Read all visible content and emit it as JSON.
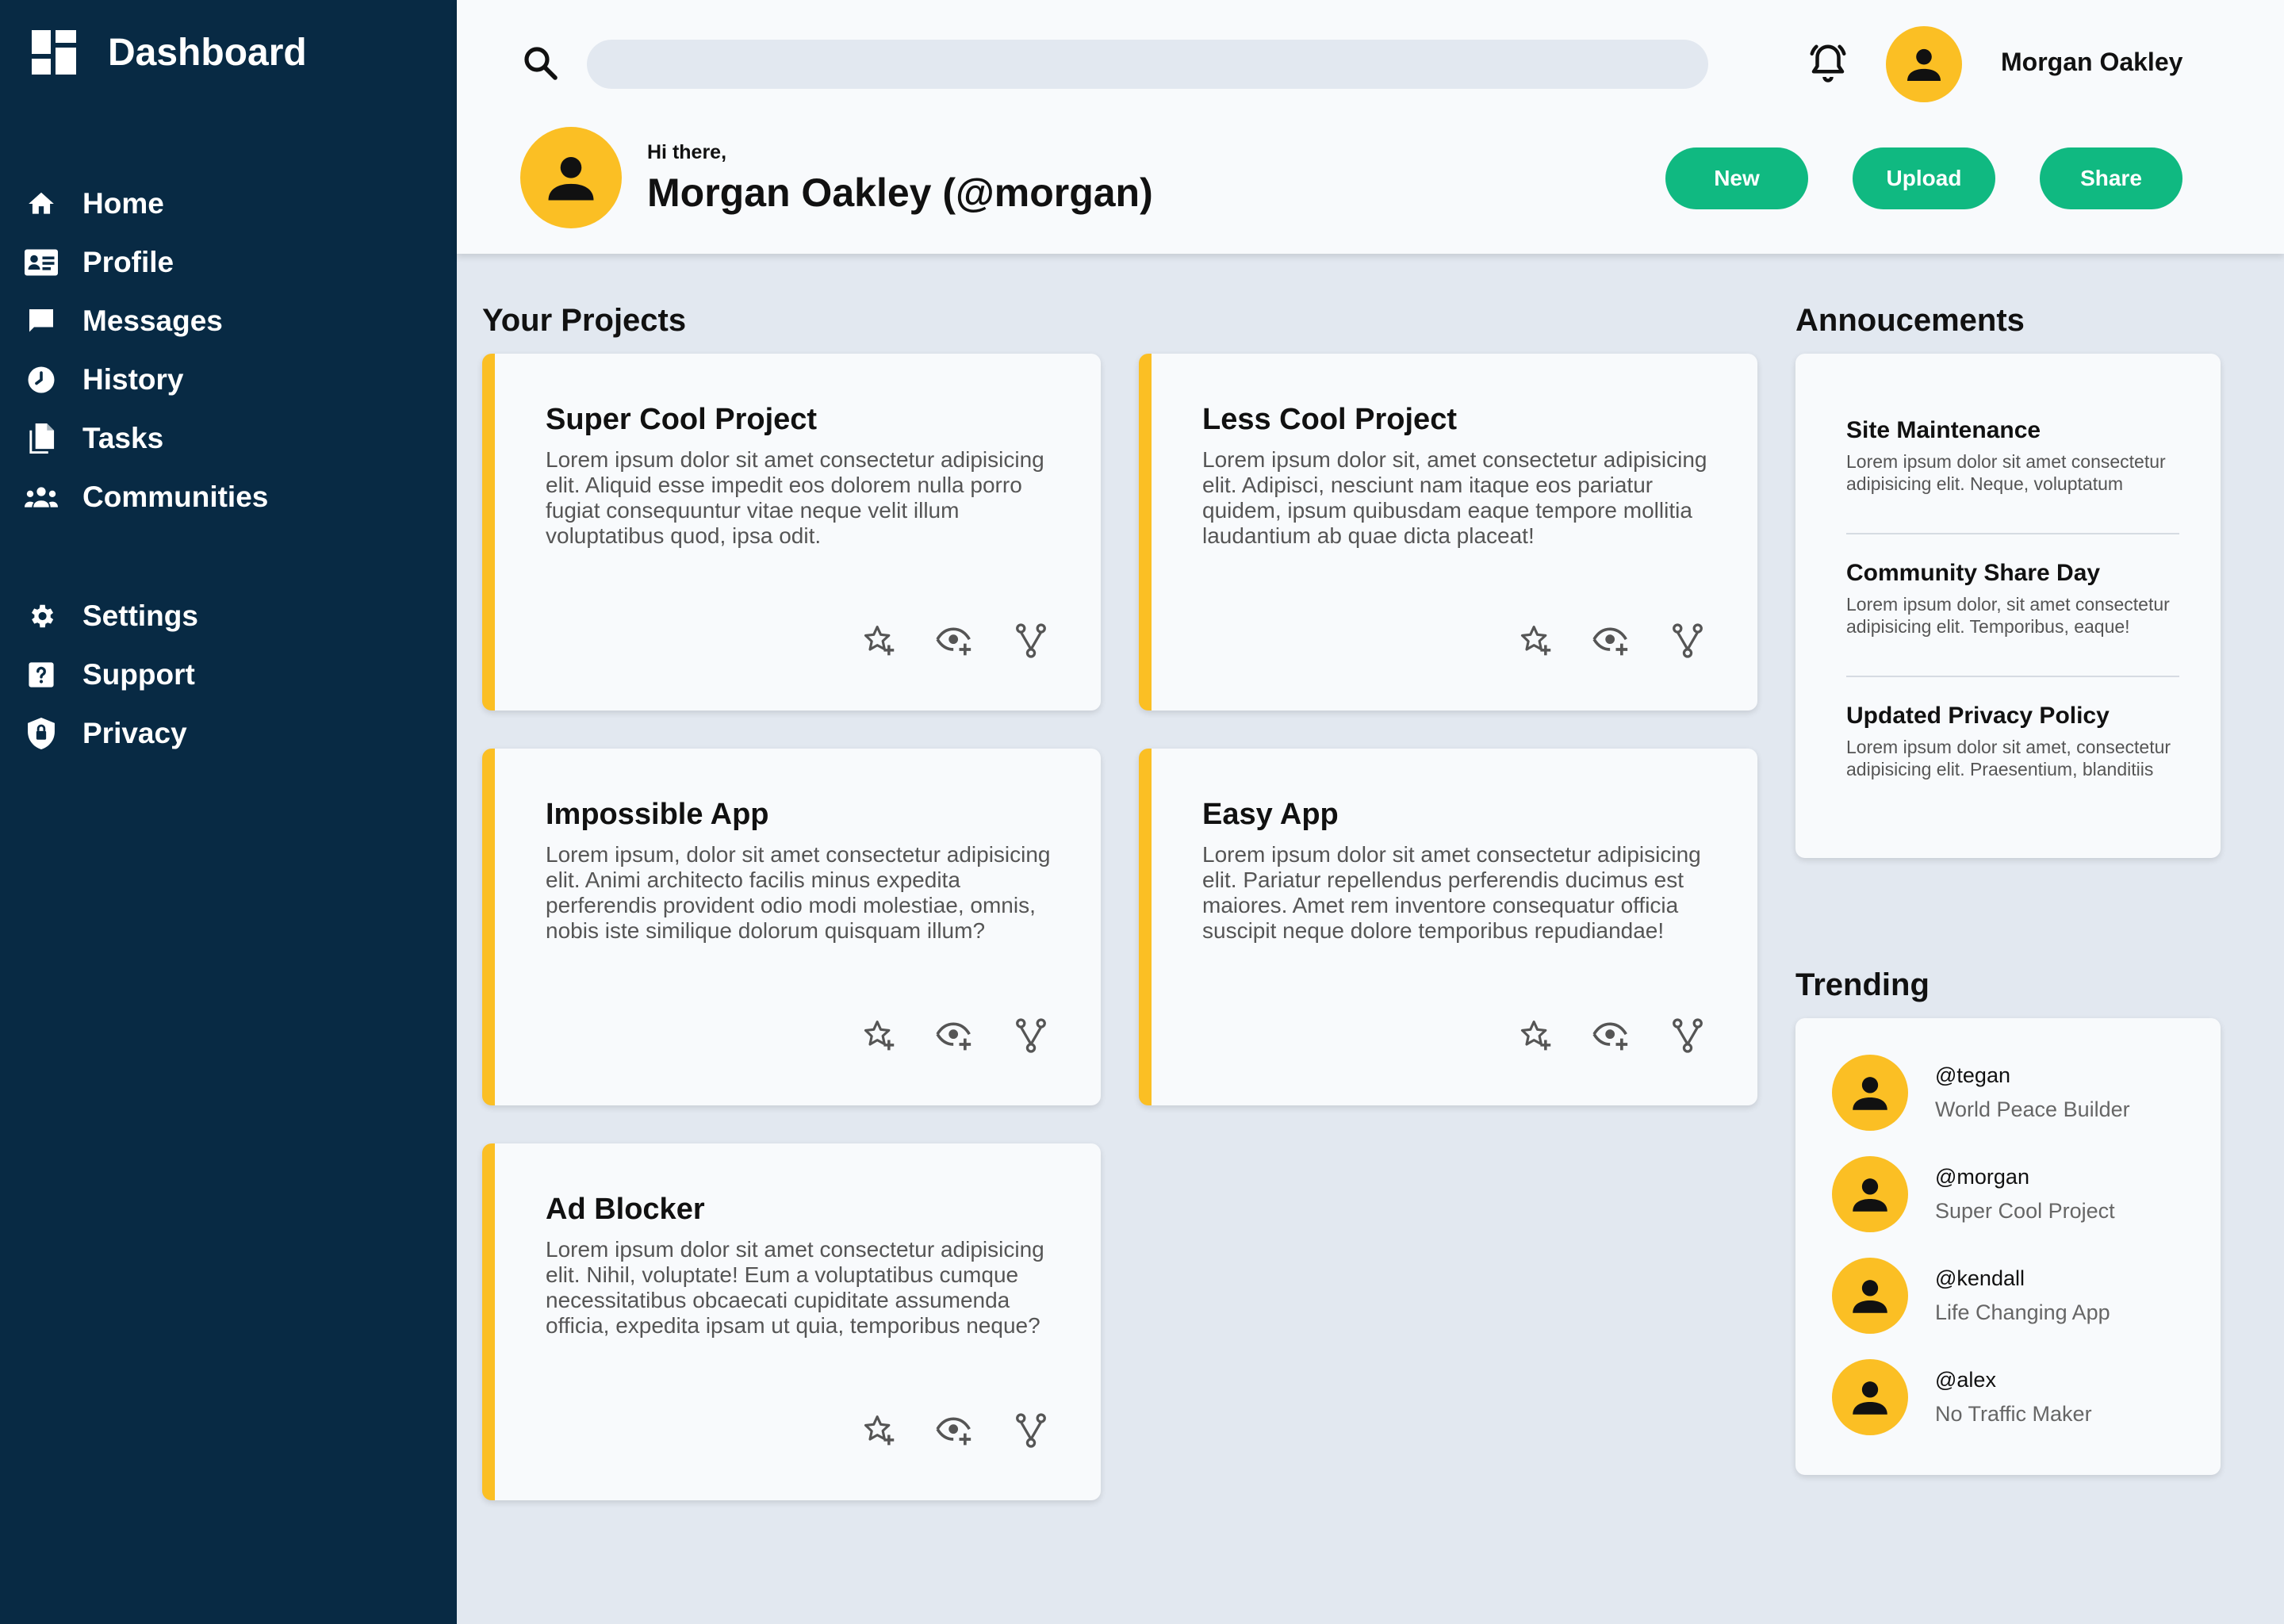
{
  "sidebar": {
    "brand": {
      "icon": "dashboard-icon",
      "title": "Dashboard"
    },
    "primary_items": [
      {
        "label": "Home",
        "icon": "home-icon"
      },
      {
        "label": "Profile",
        "icon": "id-card-icon"
      },
      {
        "label": "Messages",
        "icon": "message-icon"
      },
      {
        "label": "History",
        "icon": "clock-icon"
      },
      {
        "label": "Tasks",
        "icon": "documents-icon"
      },
      {
        "label": "Communities",
        "icon": "people-icon"
      }
    ],
    "secondary_items": [
      {
        "label": "Settings",
        "icon": "gear-icon"
      },
      {
        "label": "Support",
        "icon": "help-icon"
      },
      {
        "label": "Privacy",
        "icon": "shield-icon"
      }
    ]
  },
  "header": {
    "search": {
      "placeholder": "",
      "icon": "search-icon"
    },
    "notifications_icon": "bell-icon",
    "user_name": "Morgan Oakley",
    "greeting": "Hi there,",
    "full_name": "Morgan Oakley (@morgan)",
    "buttons": {
      "new": "New",
      "upload": "Upload",
      "share": "Share"
    }
  },
  "projects": {
    "title": "Your Projects",
    "items": [
      {
        "title": "Super Cool Project",
        "description": "Lorem ipsum dolor sit amet consectetur adipisicing elit. Aliquid esse impedit eos dolorem nulla porro fugiat consequuntur vitae neque velit illum voluptatibus quod, ipsa odit."
      },
      {
        "title": "Less Cool Project",
        "description": "Lorem ipsum dolor sit, amet consectetur adipisicing elit. Adipisci, nesciunt nam itaque eos pariatur quidem, ipsum quibusdam eaque tempore mollitia laudantium ab quae dicta placeat!"
      },
      {
        "title": "Impossible App",
        "description": "Lorem ipsum, dolor sit amet consectetur adipisicing elit. Animi architecto facilis minus expedita perferendis provident odio modi molestiae, omnis, nobis iste similique dolorum quisquam illum?"
      },
      {
        "title": "Easy App",
        "description": "Lorem ipsum dolor sit amet consectetur adipisicing elit. Pariatur repellendus perferendis ducimus est maiores. Amet rem inventore consequatur officia suscipit neque dolore temporibus repudiandae!"
      },
      {
        "title": "Ad Blocker",
        "description": "Lorem ipsum dolor sit amet consectetur adipisicing elit. Nihil, voluptate! Eum a voluptatibus cumque necessitatibus obcaecati cupiditate assumenda officia, expedita ipsam ut quia, temporibus neque?"
      }
    ],
    "action_icons": [
      "star-plus-icon",
      "eye-plus-icon",
      "fork-icon"
    ]
  },
  "announcements": {
    "title": "Annoucements",
    "items": [
      {
        "title": "Site Maintenance",
        "text": "Lorem ipsum dolor sit amet consectetur adipisicing elit. Neque, voluptatum"
      },
      {
        "title": "Community Share Day",
        "text": "Lorem ipsum dolor, sit amet consectetur adipisicing elit. Temporibus, eaque!"
      },
      {
        "title": "Updated Privacy Policy",
        "text": "Lorem ipsum dolor sit amet, consectetur adipisicing elit. Praesentium, blanditiis"
      }
    ]
  },
  "trending": {
    "title": "Trending",
    "items": [
      {
        "handle": "@tegan",
        "project": "World Peace Builder"
      },
      {
        "handle": "@morgan",
        "project": "Super Cool Project"
      },
      {
        "handle": "@kendall",
        "project": "Life Changing App"
      },
      {
        "handle": "@alex",
        "project": "No Traffic Maker"
      }
    ]
  },
  "colors": {
    "sidebar_bg": "#082a44",
    "accent_yellow": "#fbbf24",
    "button_green": "#10b981",
    "page_bg": "#e2e8f0",
    "card_bg": "#f8fafc"
  }
}
